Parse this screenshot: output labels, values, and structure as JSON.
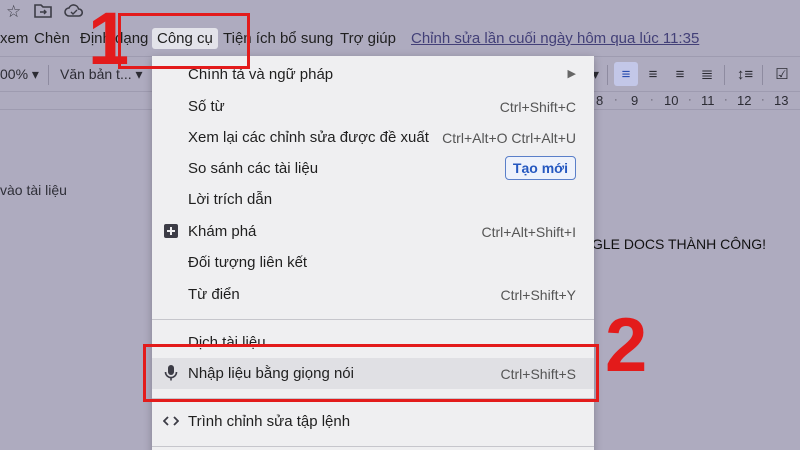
{
  "menubar": {
    "items": [
      "xem",
      "Chèn",
      "Định dạng",
      "Công cụ",
      "Tiện ích bổ sung",
      "Trợ giúp"
    ],
    "last_edit": "Chỉnh sửa lần cuối ngày hôm qua lúc 11:35"
  },
  "toolbar": {
    "zoom": "00%",
    "style": "Văn bản t...",
    "align_active": "left"
  },
  "ruler": {
    "numbers": [
      "8",
      "9",
      "10",
      "11",
      "12",
      "13"
    ]
  },
  "document": {
    "left_text": "vào tài liệu",
    "body_text": "GLE DOCS THÀNH CÔNG!"
  },
  "tools_menu": {
    "items": [
      {
        "label": "Chính tả và ngữ pháp",
        "shortcut": "",
        "icon": "",
        "submenu": true
      },
      {
        "label": "Số từ",
        "shortcut": "Ctrl+Shift+C",
        "icon": ""
      },
      {
        "label": "Xem lại các chỉnh sửa được đề xuất",
        "shortcut": "Ctrl+Alt+O Ctrl+Alt+U",
        "icon": ""
      },
      {
        "label": "So sánh các tài liệu",
        "shortcut": "",
        "icon": "",
        "badge": "Tạo mới"
      },
      {
        "label": "Lời trích dẫn",
        "shortcut": "",
        "icon": ""
      },
      {
        "label": "Khám phá",
        "shortcut": "Ctrl+Alt+Shift+I",
        "icon": "explore-plus-icon"
      },
      {
        "label": "Đối tượng liên kết",
        "shortcut": "",
        "icon": ""
      },
      {
        "label": "Từ điển",
        "shortcut": "Ctrl+Shift+Y",
        "icon": ""
      },
      {
        "label": "Dịch tài liệu",
        "shortcut": "",
        "icon": ""
      },
      {
        "label": "Nhập liệu bằng giọng nói",
        "shortcut": "Ctrl+Shift+S",
        "icon": "microphone-icon",
        "highlighted": true
      },
      {
        "label": "Trình chỉnh sửa tập lệnh",
        "shortcut": "",
        "icon": "code-icon"
      }
    ]
  },
  "annotations": {
    "step1": "1",
    "step2": "2",
    "color": "#e31b1b"
  }
}
